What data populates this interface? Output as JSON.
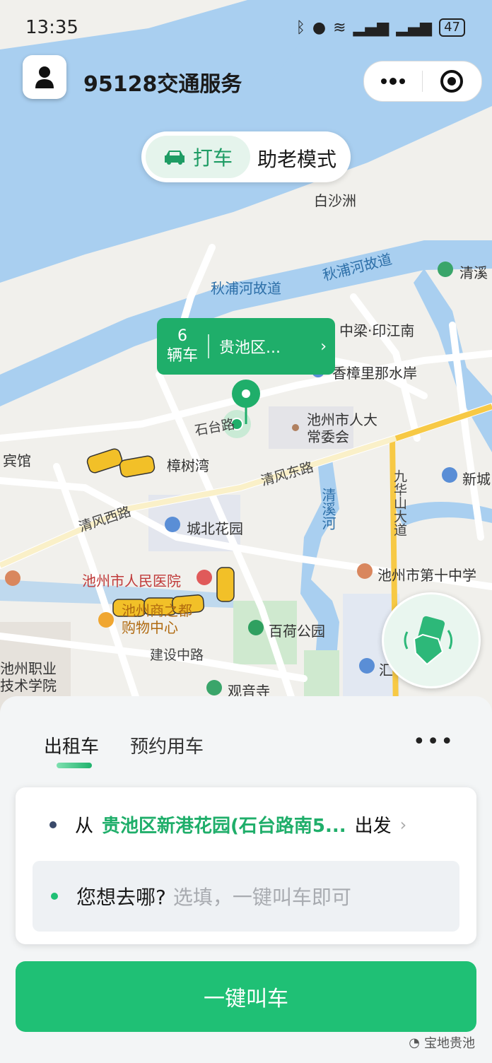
{
  "status_bar": {
    "time": "13:35",
    "battery": "47"
  },
  "header": {
    "title": "95128交通服务"
  },
  "mode_switch": {
    "taxi_label": "打车",
    "elder_label": "助老模式"
  },
  "map": {
    "labels": {
      "baishazhou": "白沙洲",
      "qiupu_old_1": "秋浦河故道",
      "qiupu_old_2": "秋浦河故道",
      "qingxi_top": "清溪",
      "zhongliang": "中梁·印江南",
      "xiangzhang": "香樟里那水岸",
      "renda": "池州市人大\n常委会",
      "shitai": "石台路",
      "binguan": "宾馆",
      "zhangshuwan": "樟树湾",
      "qingfeng_east": "清风东路",
      "qingfeng_west": "清风西路",
      "qingxihe": "清溪河",
      "jiuhuashan": "九华山大道",
      "xincheng": "新城",
      "chengbei": "城北花园",
      "hospital": "池州市人民医院",
      "school": "池州市第十中学",
      "mall": "池州商之都\n购物中心",
      "baihe": "百荷公园",
      "jianshe": "建设中路",
      "vocational": "池州职业\n技术学院",
      "guanyin": "观音寺",
      "hui": "汇"
    }
  },
  "car_bubble": {
    "count": "6",
    "unit": "辆车",
    "area": "贵池区..."
  },
  "panel": {
    "tab_taxi": "出租车",
    "tab_reserve": "预约用车",
    "from_prefix": "从",
    "from_place": "贵池区新港花园(石台路南5...",
    "from_suffix": "出发",
    "to_question": "您想去哪?",
    "to_hint": "选填，一键叫车即可",
    "call_button": "一键叫车"
  },
  "watermark": "宝地贵池",
  "colors": {
    "accent": "#1fae6a",
    "button": "#1fc075",
    "water": "#a9cff0"
  }
}
